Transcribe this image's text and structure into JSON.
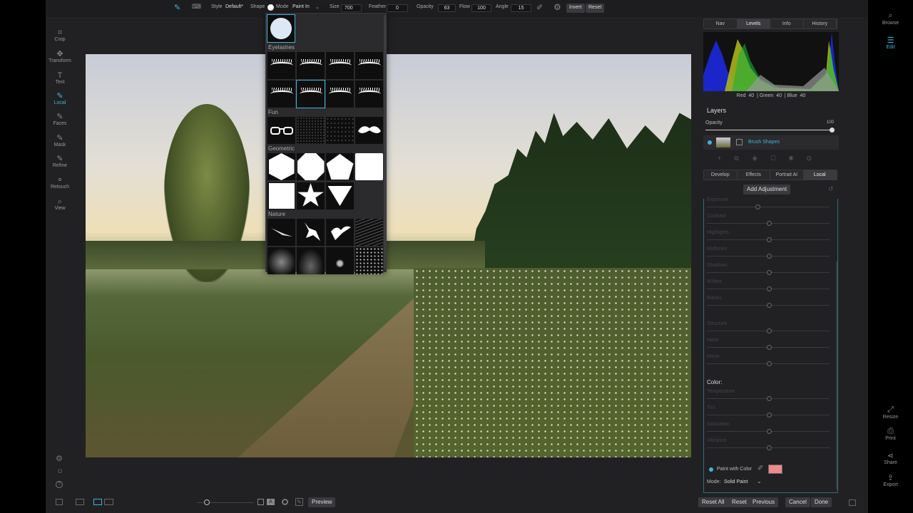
{
  "toolbar": {
    "style_label": "Style",
    "style_value": "Default*",
    "shape_label": "Shape",
    "mode_label": "Mode",
    "mode_value": "Paint In",
    "size_label": "Size",
    "size_value": "700",
    "feather_label": "Feather",
    "feather_value": "0",
    "opacity_label": "Opacity",
    "opacity_value": "63",
    "flow_label": "Flow",
    "flow_value": "100",
    "angle_label": "Angle",
    "angle_value": "15",
    "invert_label": "Invert",
    "reset_label": "Reset"
  },
  "left_tools": [
    {
      "label": "Crop",
      "icon": "crop-icon"
    },
    {
      "label": "Transform",
      "icon": "move-icon"
    },
    {
      "label": "Text",
      "icon": "text-icon"
    },
    {
      "label": "Local",
      "icon": "brush-icon"
    },
    {
      "label": "Faces",
      "icon": "faces-icon"
    },
    {
      "label": "Mask",
      "icon": "mask-icon"
    },
    {
      "label": "Refine",
      "icon": "refine-icon"
    },
    {
      "label": "Retouch",
      "icon": "retouch-icon"
    },
    {
      "label": "View",
      "icon": "zoom-icon"
    }
  ],
  "brush_popup": {
    "sections": {
      "eyelashes": "Eyelashes",
      "fun": "Fun",
      "geometric": "Geometric",
      "nature": "Nature"
    }
  },
  "right_panel": {
    "top_tabs": [
      "Nav",
      "Levels",
      "Info",
      "History"
    ],
    "histogram_readout": "Red  40  | Green  40  | Blue  40",
    "layers_title": "Layers",
    "opacity_label": "Opacity",
    "opacity_value": "100",
    "layer_name": "Brush Shapes",
    "module_tabs": [
      "Develop",
      "Effects",
      "Portrait AI",
      "Local"
    ],
    "add_adjustment": "Add Adjustment",
    "sliders_group1": [
      "Exposure",
      "Contrast",
      "Highlights",
      "Midtones",
      "Shadows",
      "Whites",
      "Blacks"
    ],
    "sliders_group2": [
      "Structure",
      "Haze",
      "Noise"
    ],
    "color_heading": "Color:",
    "sliders_group3": [
      "Temperature",
      "Tint",
      "Saturation",
      "Vibrance"
    ],
    "paint_with_color": "Paint with Color",
    "paint_color": "#f08a8a",
    "mode_label": "Mode:",
    "mode_value": "Solid Paint"
  },
  "bottom_bar": {
    "preview_label": "Preview",
    "reset_all": "Reset All",
    "reset": "Reset",
    "previous": "Previous",
    "cancel": "Cancel",
    "done": "Done"
  },
  "right_tools": [
    {
      "label": "Browse",
      "icon": "browse-icon"
    },
    {
      "label": "Edit",
      "icon": "edit-icon"
    },
    {
      "label": "Resize",
      "icon": "resize-icon"
    },
    {
      "label": "Print",
      "icon": "print-icon"
    },
    {
      "label": "Share",
      "icon": "share-icon"
    },
    {
      "label": "Export",
      "icon": "export-icon"
    }
  ],
  "colors": {
    "accent": "#3fb4d6",
    "background": "#212124"
  }
}
